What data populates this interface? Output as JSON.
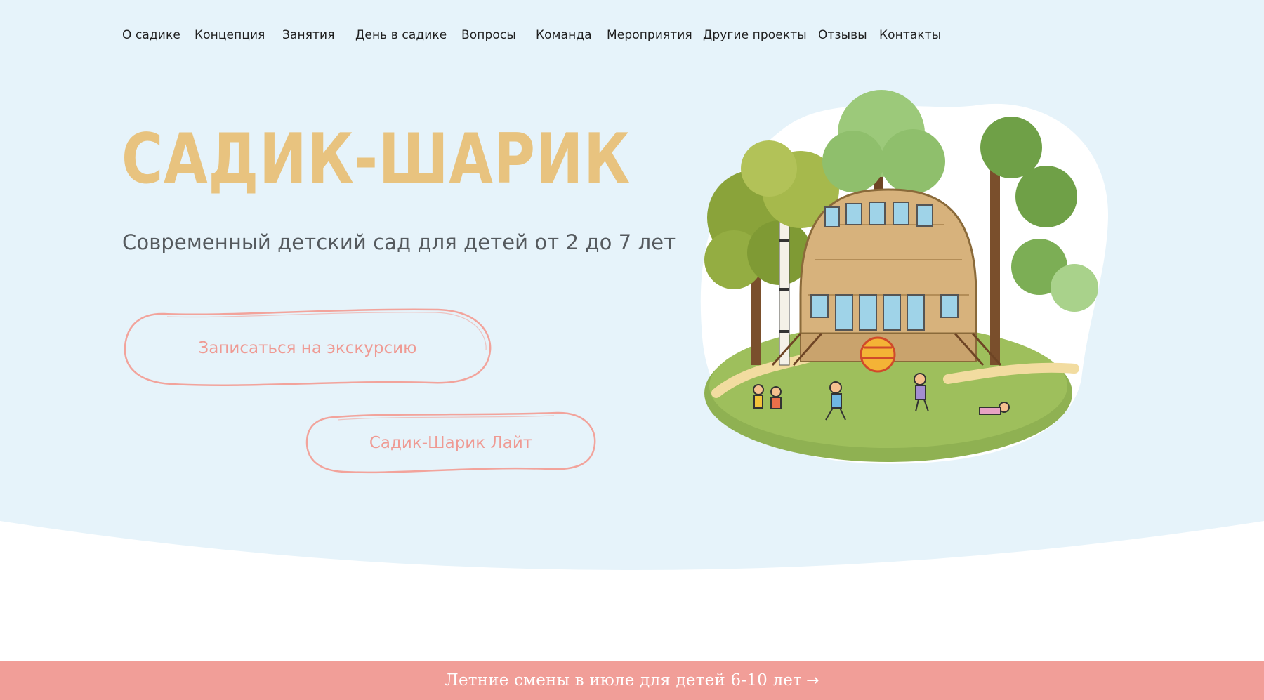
{
  "nav": {
    "items": [
      {
        "label": "О садике"
      },
      {
        "label": "Концепция"
      },
      {
        "label": "Занятия"
      },
      {
        "label": "День в садике"
      },
      {
        "label": "Вопросы"
      },
      {
        "label": "Команда"
      },
      {
        "label": "Мероприятия"
      },
      {
        "label": "Другие проекты"
      },
      {
        "label": "Отзывы"
      },
      {
        "label": "Контакты"
      }
    ]
  },
  "hero": {
    "title": "САДИК-ШАРИК",
    "subtitle": "Современный детский сад для детей от 2 до 7 лет",
    "cta_primary": "Записаться на экскурсию",
    "cta_secondary": "Садик-Шарик Лайт"
  },
  "promo": {
    "label": "Летние смены в июле для детей 6-10 лет",
    "arrow_icon": "→"
  },
  "colors": {
    "hero_background": "#e6f3fa",
    "title": "#e8c37f",
    "accent": "#f19e98",
    "button_text": "#ef9a93"
  }
}
